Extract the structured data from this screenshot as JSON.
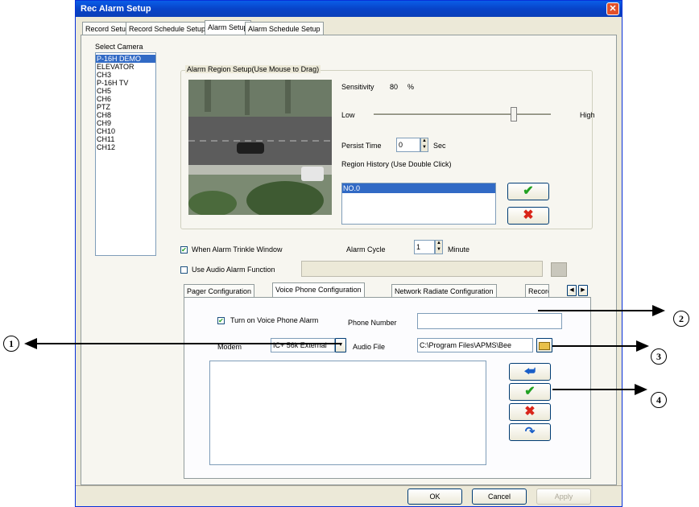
{
  "window": {
    "title": "Rec Alarm Setup",
    "close": "✕"
  },
  "tabs": [
    "Record Setup",
    "Record Schedule Setup",
    "Alarm Setup",
    "Alarm Schedule Setup"
  ],
  "camera": {
    "label": "Select Camera",
    "items": [
      "P-16H DEMO",
      "ELEVATOR",
      "CH3",
      "P-16H TV",
      "CH5",
      "CH6",
      "PTZ",
      "CH8",
      "CH9",
      "CH10",
      "CH11",
      "CH12"
    ],
    "selected": 0
  },
  "region": {
    "label": "Alarm Region Setup(Use Mouse to Drag)",
    "sensitivity_label": "Sensitivity",
    "sensitivity_value": "80",
    "sensitivity_unit": "%",
    "low": "Low",
    "high": "High",
    "slider_fraction": 0.8,
    "persist_label": "Persist Time",
    "persist_value": "0",
    "persist_unit": "Sec",
    "history_label": "Region History (Use Double Click)",
    "history_items": [
      "NO.0"
    ]
  },
  "options": {
    "trinkle_label": "When Alarm Trinkle Window",
    "trinkle_checked": true,
    "cycle_label": "Alarm Cycle",
    "cycle_value": "1",
    "cycle_unit": "Minute",
    "audio_label": "Use Audio Alarm Function",
    "audio_checked": false
  },
  "subtabs": [
    "Pager Configuration",
    "Voice Phone Configuration",
    "Network Radiate Configuration",
    "Record"
  ],
  "voice": {
    "turn_on_label": "Turn on Voice Phone Alarm",
    "turn_on_checked": true,
    "phone_label": "Phone Number",
    "phone_value": "",
    "modem_label": "Modem",
    "modem_value": "IC+ 56k External",
    "audio_label": "Audio File",
    "audio_value": "C:\\Program Files\\APMS\\Bee"
  },
  "footer": {
    "ok": "OK",
    "cancel": "Cancel",
    "apply": "Apply"
  },
  "callouts": [
    "1",
    "2",
    "3",
    "4"
  ],
  "colors": {
    "accept": "#21a121",
    "reject": "#d9251a",
    "arrow": "#1a5fc8"
  }
}
